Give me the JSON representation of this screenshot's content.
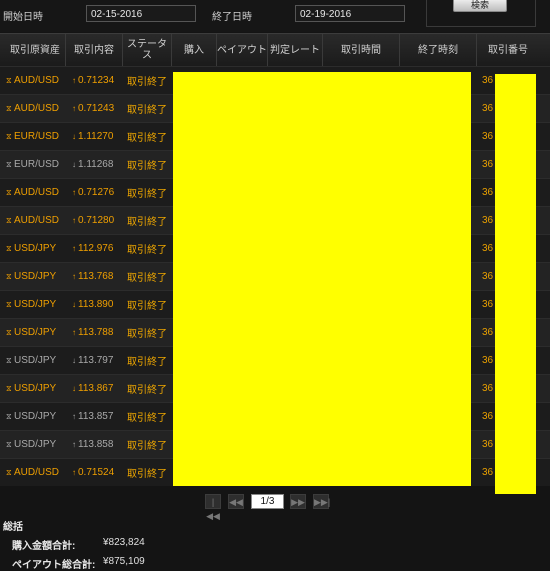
{
  "filter": {
    "start_label": "開始日時",
    "start_value": "02-15-2016",
    "end_label": "終了日時",
    "end_value": "02-19-2016",
    "search_label": "検索"
  },
  "columns": [
    "取引原資産",
    "取引内容",
    "ステータス",
    "購入",
    "ペイアウト",
    "判定レート",
    "取引時間",
    "終了時刻",
    "取引番号"
  ],
  "rows": [
    {
      "asset": "AUD/USD",
      "dir": "up",
      "rate": "0.71234",
      "status": "取引終了",
      "num": "36",
      "highlight": true
    },
    {
      "asset": "AUD/USD",
      "dir": "up",
      "rate": "0.71243",
      "status": "取引終了",
      "num": "36",
      "highlight": true
    },
    {
      "asset": "EUR/USD",
      "dir": "down",
      "rate": "1.11270",
      "status": "取引終了",
      "num": "36",
      "highlight": true
    },
    {
      "asset": "EUR/USD",
      "dir": "down",
      "rate": "1.11268",
      "status": "取引終了",
      "num": "36",
      "highlight": false
    },
    {
      "asset": "AUD/USD",
      "dir": "up",
      "rate": "0.71276",
      "status": "取引終了",
      "num": "36",
      "highlight": true
    },
    {
      "asset": "AUD/USD",
      "dir": "up",
      "rate": "0.71280",
      "status": "取引終了",
      "num": "36",
      "highlight": true
    },
    {
      "asset": "USD/JPY",
      "dir": "up",
      "rate": "112.976",
      "status": "取引終了",
      "num": "36",
      "highlight": true
    },
    {
      "asset": "USD/JPY",
      "dir": "up",
      "rate": "113.768",
      "status": "取引終了",
      "num": "36",
      "highlight": true
    },
    {
      "asset": "USD/JPY",
      "dir": "down",
      "rate": "113.890",
      "status": "取引終了",
      "num": "36",
      "highlight": true
    },
    {
      "asset": "USD/JPY",
      "dir": "up",
      "rate": "113.788",
      "status": "取引終了",
      "num": "36",
      "highlight": true
    },
    {
      "asset": "USD/JPY",
      "dir": "down",
      "rate": "113.797",
      "status": "取引終了",
      "num": "36",
      "highlight": false
    },
    {
      "asset": "USD/JPY",
      "dir": "down",
      "rate": "113.867",
      "status": "取引終了",
      "num": "36",
      "highlight": true
    },
    {
      "asset": "USD/JPY",
      "dir": "up",
      "rate": "113.857",
      "status": "取引終了",
      "num": "36",
      "highlight": false
    },
    {
      "asset": "USD/JPY",
      "dir": "up",
      "rate": "113.858",
      "status": "取引終了",
      "num": "36",
      "highlight": false
    },
    {
      "asset": "AUD/USD",
      "dir": "up",
      "rate": "0.71524",
      "status": "取引終了",
      "num": "36",
      "highlight": true
    }
  ],
  "pager": {
    "first": "|◀◀",
    "prev": "◀◀",
    "page": "1/3",
    "next": "▶▶",
    "last": "▶▶|"
  },
  "summary": {
    "title": "総括",
    "purchase_label": "購入金額合計:",
    "purchase_value": "¥823,824",
    "payout_label": "ペイアウト総合計:",
    "payout_value": "¥875,109"
  },
  "colors": {
    "accent": "#f0a000",
    "redaction": "#ffff00"
  }
}
